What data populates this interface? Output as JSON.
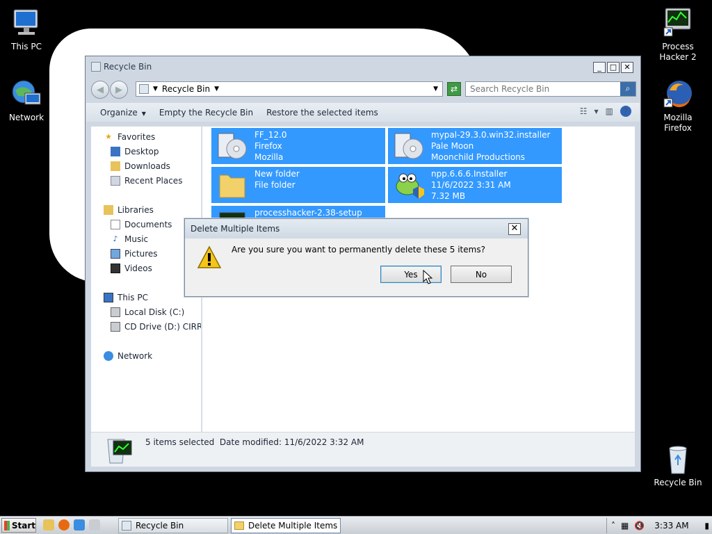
{
  "desktop": {
    "icons": [
      {
        "label": "This PC"
      },
      {
        "label": "Network"
      },
      {
        "label": "Process Hacker 2"
      },
      {
        "label": "Mozilla Firefox"
      },
      {
        "label": "Recycle Bin"
      }
    ]
  },
  "explorer": {
    "title": "Recycle Bin",
    "address": "Recycle Bin",
    "search_placeholder": "Search Recycle Bin",
    "commands": {
      "organize": "Organize",
      "empty": "Empty the Recycle Bin",
      "restore": "Restore the selected items"
    },
    "nav": {
      "favorites": "Favorites",
      "desktop": "Desktop",
      "downloads": "Downloads",
      "recent": "Recent Places",
      "libraries": "Libraries",
      "documents": "Documents",
      "music": "Music",
      "pictures": "Pictures",
      "videos": "Videos",
      "this_pc": "This PC",
      "local_disk": "Local Disk (C:)",
      "cd_drive": "CD Drive (D:) CIRRUS",
      "network": "Network"
    },
    "files": [
      {
        "name": "FF_12.0",
        "line2": "Firefox",
        "line3": "Mozilla"
      },
      {
        "name": "mypal-29.3.0.win32.installer",
        "line2": "Pale Moon",
        "line3": "Moonchild Productions"
      },
      {
        "name": "New folder",
        "line2": "File folder",
        "line3": ""
      },
      {
        "name": "npp.6.6.6.Installer",
        "line2": "11/6/2022 3:31 AM",
        "line3": "7.32 MB"
      },
      {
        "name": "processhacker-2.38-setup",
        "line2": "",
        "line3": ""
      }
    ],
    "status": {
      "selected": "5 items selected",
      "modified": "Date modified: 11/6/2022 3:32 AM"
    }
  },
  "dialog": {
    "title": "Delete Multiple Items",
    "message": "Are you sure you want to permanently delete these 5 items?",
    "yes": "Yes",
    "no": "No"
  },
  "taskbar": {
    "start": "Start",
    "tasks": [
      "Recycle Bin",
      "Delete Multiple Items"
    ],
    "clock": "3:33 AM"
  }
}
